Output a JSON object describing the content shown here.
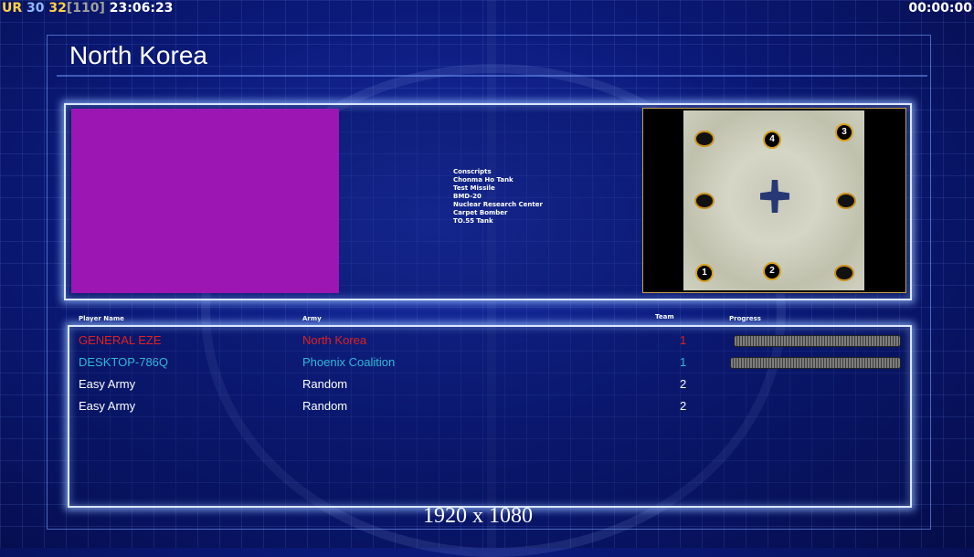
{
  "overlay": {
    "fps_prefix": "UR",
    "fps_value": "30",
    "fps_value2": "32",
    "fps_bracket": "[110]",
    "clock": "23:06:23",
    "timer": "00:00:00"
  },
  "lobby": {
    "title": "North Korea",
    "units": [
      "Conscripts",
      "Chonma Ho Tank",
      "Test Missile",
      "BMD-20",
      "Nuclear Research Center",
      "Carpet Bomber",
      "TO.55 Tank"
    ],
    "map_positions": [
      "1",
      "2",
      "3",
      "4"
    ],
    "columns": {
      "player": "Player Name",
      "army": "Army",
      "team": "Team",
      "progress": "Progress"
    },
    "players": [
      {
        "name": "GENERAL EZE",
        "army": "North Korea",
        "team": "1",
        "color": "#e0201e",
        "progress": 1.0
      },
      {
        "name": "DESKTOP-786Q",
        "army": "Phoenix Coalition",
        "team": "1",
        "color": "#30b8d8",
        "progress": 1.0
      },
      {
        "name": "Easy Army",
        "army": "Random",
        "team": "2",
        "color": "#ffffff"
      },
      {
        "name": "Easy Army",
        "army": "Random",
        "team": "2",
        "color": "#ffffff"
      }
    ]
  },
  "resolution": "1920 x 1080",
  "colors": {
    "accent": "#9c16b3",
    "panel_border": "#dbe7ff"
  }
}
